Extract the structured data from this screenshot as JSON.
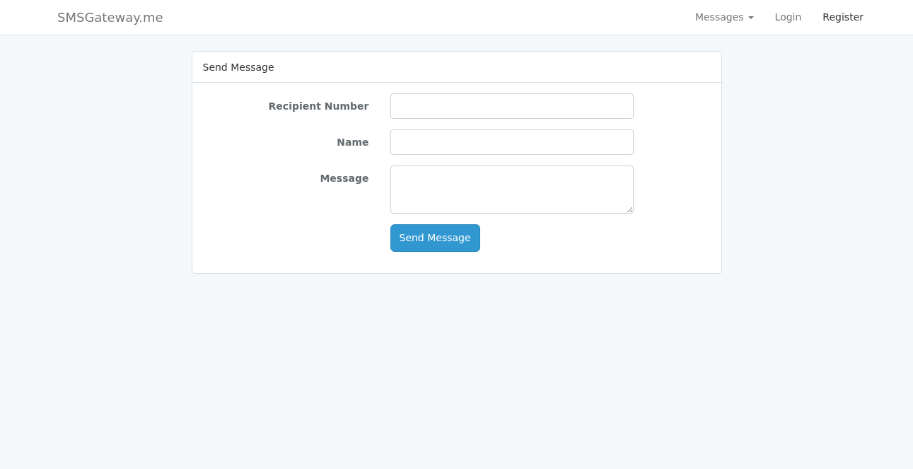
{
  "navbar": {
    "brand": "SMSGateway.me",
    "links": [
      {
        "label": "Messages",
        "dropdown": true,
        "selected": false
      },
      {
        "label": "Login",
        "dropdown": false,
        "selected": false
      },
      {
        "label": "Register",
        "dropdown": false,
        "selected": true
      }
    ]
  },
  "card": {
    "title": "Send Message",
    "fields": [
      {
        "label": "Recipient Number",
        "kind": "input"
      },
      {
        "label": "Name",
        "kind": "input"
      },
      {
        "label": "Message",
        "kind": "textarea"
      }
    ],
    "button": "Send Message"
  }
}
